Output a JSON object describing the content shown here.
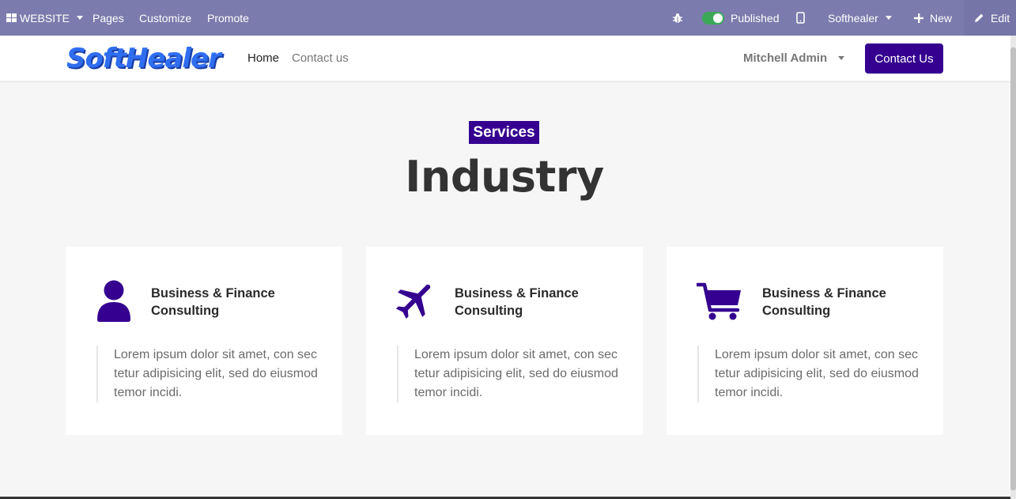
{
  "admin_bar": {
    "website_menu": "WEBSITE",
    "pages": "Pages",
    "customize": "Customize",
    "promote": "Promote",
    "published": "Published",
    "company": "Softhealer",
    "new": "New",
    "edit": "Edit",
    "color": "#7c7bad"
  },
  "header": {
    "logo_text": "SoftHealer",
    "nav": [
      {
        "label": "Home",
        "active": true
      },
      {
        "label": "Contact us",
        "active": false
      }
    ],
    "user": "Mitchell Admin",
    "contact_button": "Contact Us",
    "accent": "#35008f"
  },
  "hero": {
    "badge": "Services",
    "title": "Industry"
  },
  "cards": [
    {
      "icon": "user-icon",
      "title_line1": "Business & Finance",
      "title_line2": "Consulting",
      "description": "Lorem ipsum dolor sit amet, con sec tetur adipisicing elit, sed do eiusmod temor incidi."
    },
    {
      "icon": "airplane-icon",
      "title_line1": "Business & Finance",
      "title_line2": "Consulting",
      "description": "Lorem ipsum dolor sit amet, con sec tetur adipisicing elit, sed do eiusmod temor incidi."
    },
    {
      "icon": "shopping-cart-icon",
      "title_line1": "Business & Finance",
      "title_line2": "Consulting",
      "description": "Lorem ipsum dolor sit amet, con sec tetur adipisicing elit, sed do eiusmod temor incidi."
    }
  ]
}
